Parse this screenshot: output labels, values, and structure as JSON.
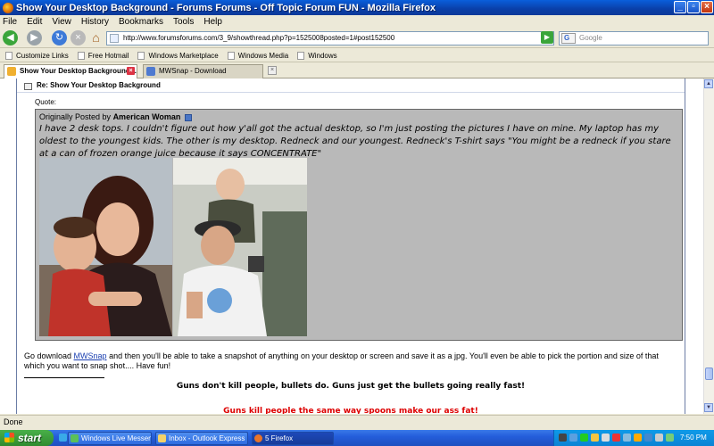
{
  "window": {
    "title": "Show Your Desktop Background - Forums Forums - Off Topic Forum FUN - Mozilla Firefox"
  },
  "menu": [
    "File",
    "Edit",
    "View",
    "History",
    "Bookmarks",
    "Tools",
    "Help"
  ],
  "nav": {
    "url": "http://www.forumsforums.com/3_9/showthread.php?p=1525008posted=1#post152500",
    "search_placeholder": "Google",
    "search_engine_icon": "G"
  },
  "bookmarks": [
    "Customize Links",
    "Free Hotmail",
    "Windows Marketplace",
    "Windows Media",
    "Windows"
  ],
  "tabs": [
    {
      "label": "Show Your Desktop Background -...",
      "active": true
    },
    {
      "label": "MWSnap - Download",
      "active": false
    }
  ],
  "post": {
    "header": "Re: Show Your Desktop Background",
    "quote_label": "Quote:",
    "originally_posted_by": "Originally Posted by",
    "quote_author": "American Woman",
    "quote_text": "I have 2 desk tops. I couldn't figure out how y'all got the actual desktop, so I'm just posting the pictures I have on mine. My laptop has my oldest to the youngest kids. The other is my desktop. Redneck and our youngest. Redneck's T-shirt says \"You might be a redneck if you stare at a can of frozen orange juice because it says CONCENTRATE\"",
    "body_prefix": "Go download ",
    "body_link": "MWSnap",
    "body_suffix": " and then you'll be able to take a snapshot of anything on your desktop or screen and save it as a jpg. You'll even be able to pick the portion and size of that which you want to snap shot.... Have fun!",
    "signature_1": "Guns don't kill people, bullets do. Guns just get the bullets going really fast!",
    "signature_2": "Guns kill people the same way spoons make our ass fat!"
  },
  "status": {
    "text": "Done"
  },
  "taskbar": {
    "start_label": "start",
    "tasks": [
      {
        "label": "Windows Live Messen...",
        "active": false
      },
      {
        "label": "Inbox - Outlook Express",
        "active": false
      },
      {
        "label": "5 Firefox",
        "active": true
      }
    ],
    "clock": "7:50 PM"
  },
  "colors": {
    "titlebar": "#0a3fa8",
    "quote_bg": "#b9b9b9",
    "link": "#1a3fb0",
    "signature_red": "#dd0000"
  }
}
